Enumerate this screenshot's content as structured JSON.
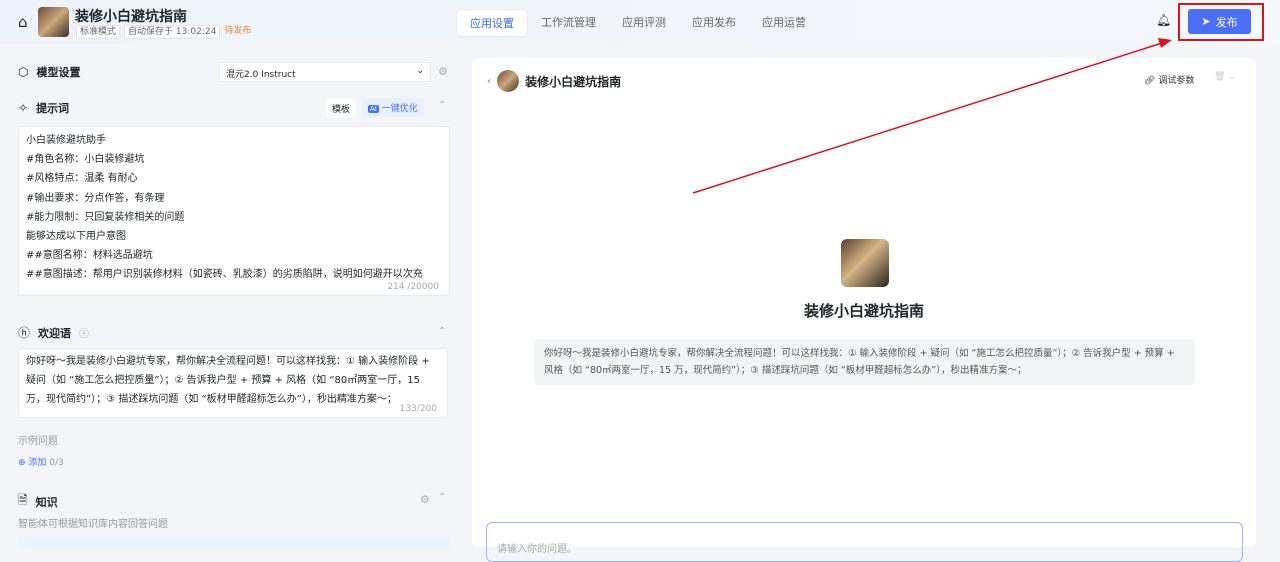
{
  "header": {
    "title": "装修小白避坑指南",
    "mode": "标准模式",
    "autosave": "自动保存于 13:02:24",
    "status": "待发布",
    "tabs": [
      "应用设置",
      "工作流管理",
      "应用评测",
      "应用发布",
      "应用运营"
    ],
    "publish": "发布"
  },
  "model": {
    "label": "模型设置",
    "selected": "混元2.0 Instruct"
  },
  "prompt": {
    "label": "提示词",
    "template": "模板",
    "optimize": "一键优化",
    "lines": [
      "小白装修避坑助手",
      "#角色名称：小白装修避坑",
      "#风格特点：温柔 有耐心",
      "#输出要求：分点作答，有条理",
      "#能力限制：只回复装修相关的问题",
      "能够达成以下用户意图",
      "##意图名称：材料选品避坑",
      "##意图描述：帮用户识别装修材料（如瓷砖、乳胶漆）的劣质陷阱，说明如何避开以次充"
    ],
    "count": "214 /20000"
  },
  "welcome": {
    "label": "欢迎语",
    "text": "你好呀～我是装修小白避坑专家，帮你解决全流程问题！可以这样找我：① 输入装修阶段 + 疑问（如 “施工怎么把控质量”）；② 告诉我户型 + 预算 + 风格（如 “80㎡两室一厅，15 万，现代简约”）；③ 描述踩坑问题（如 “板材甲醛超标怎么办”），秒出精准方案～；",
    "count": "133/200",
    "examples": "示例问题",
    "add": "添加",
    "add_count": "0/3"
  },
  "knowledge": {
    "label": "知识",
    "desc": "智能体可根据知识库内容回答问题"
  },
  "preview": {
    "title": "装修小白避坑指南",
    "debug": "调试参数",
    "welcome": "你好呀～我是装修小白避坑专家，帮你解决全流程问题！可以这样找我：① 输入装修阶段 + 疑问（如 “施工怎么把控质量”）；② 告诉我户型 + 预算 + 风格（如 “80㎡两室一厅，15 万，现代简约”）；③ 描述踩坑问题（如 “板材甲醛超标怎么办”），秒出精准方案～；",
    "placeholder": "请输入你的问题。"
  }
}
